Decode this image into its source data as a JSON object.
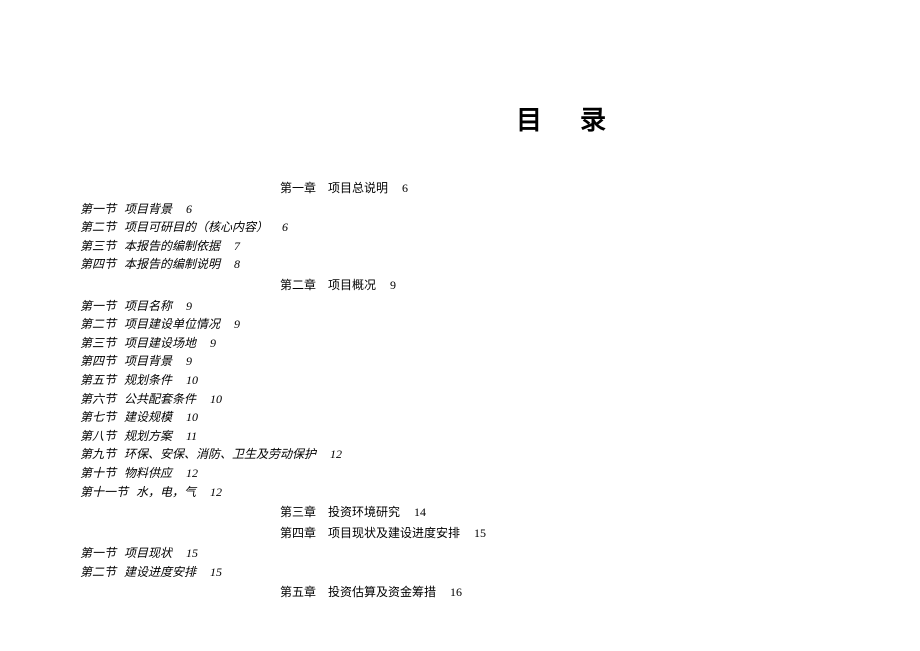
{
  "title": "目录",
  "toc": [
    {
      "type": "chapter",
      "label": "第一章",
      "title": "项目总说明",
      "page": "6"
    },
    {
      "type": "section",
      "label": "第一节",
      "title": "项目背景",
      "page": "6"
    },
    {
      "type": "section",
      "label": "第二节",
      "title": "项目可研目的（核心内容）",
      "page": "6"
    },
    {
      "type": "section",
      "label": "第三节",
      "title": "本报告的编制依据",
      "page": "7"
    },
    {
      "type": "section",
      "label": "第四节",
      "title": "本报告的编制说明",
      "page": "8"
    },
    {
      "type": "chapter",
      "label": "第二章",
      "title": "项目概况",
      "page": "9"
    },
    {
      "type": "section",
      "label": "第一节",
      "title": "项目名称",
      "page": "9"
    },
    {
      "type": "section",
      "label": "第二节",
      "title": "项目建设单位情况",
      "page": "9"
    },
    {
      "type": "section",
      "label": "第三节",
      "title": "项目建设场地",
      "page": "9"
    },
    {
      "type": "section",
      "label": "第四节",
      "title": "项目背景",
      "page": "9"
    },
    {
      "type": "section",
      "label": "第五节",
      "title": "规划条件",
      "page": "10"
    },
    {
      "type": "section",
      "label": "第六节",
      "title": "公共配套条件",
      "page": "10"
    },
    {
      "type": "section",
      "label": "第七节",
      "title": "建设规模",
      "page": "10"
    },
    {
      "type": "section",
      "label": "第八节",
      "title": "规划方案",
      "page": "11"
    },
    {
      "type": "section",
      "label": "第九节",
      "title": "环保、安保、消防、卫生及劳动保护",
      "page": "12"
    },
    {
      "type": "section",
      "label": "第十节",
      "title": "物料供应",
      "page": "12"
    },
    {
      "type": "section",
      "label": "第十一节",
      "title": "水，电，气",
      "page": "12"
    },
    {
      "type": "chapter",
      "label": "第三章",
      "title": "投资环境研究",
      "page": "14"
    },
    {
      "type": "chapter",
      "label": "第四章",
      "title": "项目现状及建设进度安排",
      "page": "15"
    },
    {
      "type": "section",
      "label": "第一节",
      "title": "项目现状",
      "page": "15"
    },
    {
      "type": "section",
      "label": "第二节",
      "title": "建设进度安排",
      "page": "15"
    },
    {
      "type": "chapter",
      "label": "第五章",
      "title": "投资估算及资金筹措",
      "page": "16"
    }
  ]
}
